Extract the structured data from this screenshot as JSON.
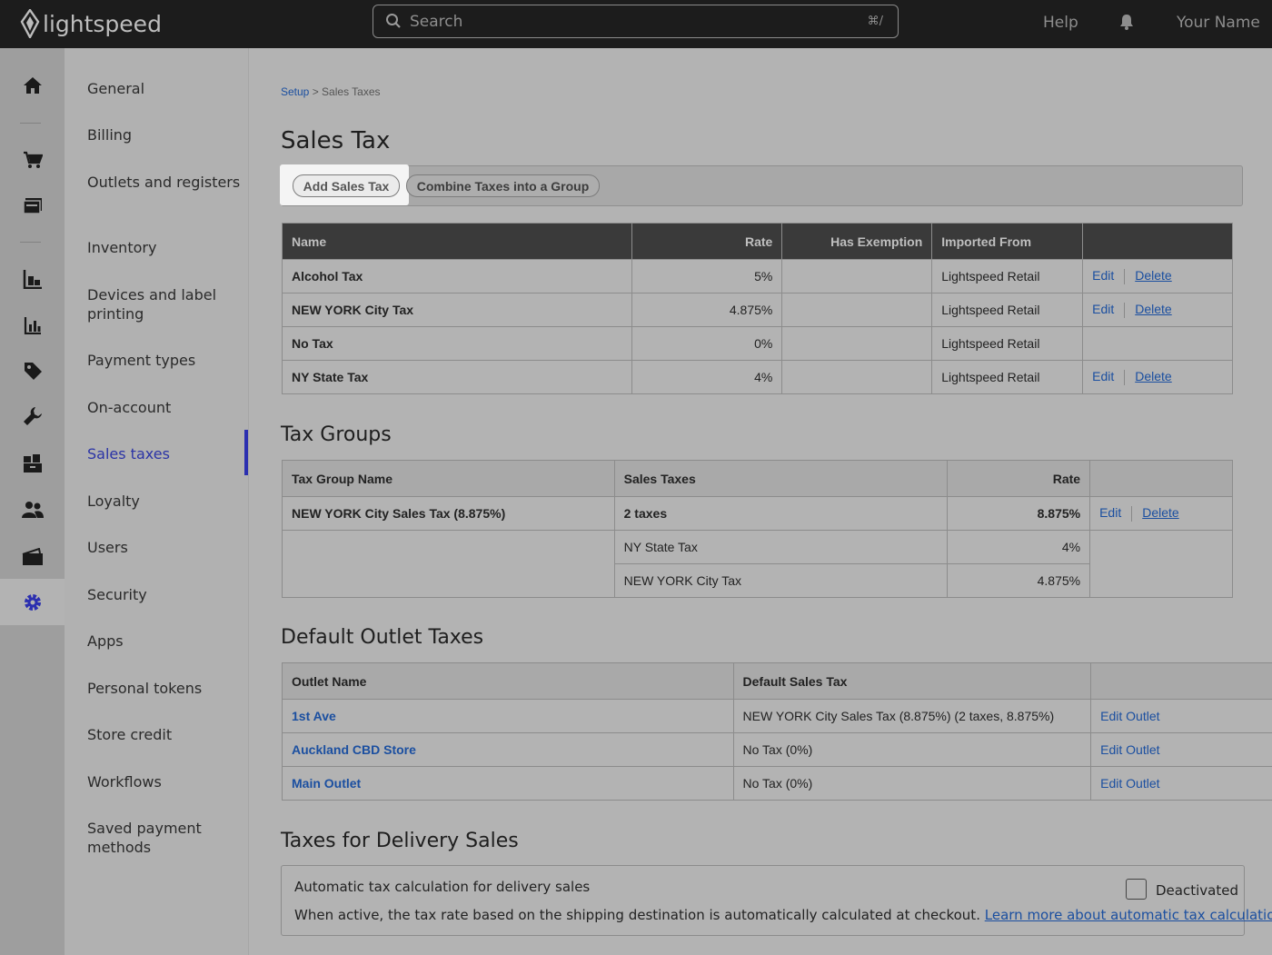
{
  "app": {
    "logo_text": "lightspeed"
  },
  "topbar": {
    "search_placeholder": "Search",
    "search_shortcut": "⌘/",
    "help": "Help",
    "user_name": "Your Name"
  },
  "rail_icons": [
    "home-icon",
    "cart-icon",
    "register-icon",
    "catalog-icon",
    "reports-icon",
    "tag-icon",
    "wrench-icon",
    "inventory-icon",
    "customers-icon",
    "wallet-icon",
    "gear-icon"
  ],
  "settings_nav": [
    "General",
    "Billing",
    "Outlets and registers",
    "Inventory",
    "Devices and label printing",
    "Payment types",
    "On-account",
    "Sales taxes",
    "Loyalty",
    "Users",
    "Security",
    "Apps",
    "Personal tokens",
    "Store credit",
    "Workflows",
    "Saved payment methods"
  ],
  "breadcrumb": {
    "root": "Setup",
    "current": "> Sales Taxes"
  },
  "page_title": "Sales Tax",
  "toolbar": {
    "add": "Add Sales Tax",
    "combine": "Combine Taxes into a Group"
  },
  "sales_tax_table": {
    "headers": {
      "name": "Name",
      "rate": "Rate",
      "exemption": "Has Exemption",
      "imported": "Imported From"
    },
    "rows": [
      {
        "name": "Alcohol Tax",
        "rate": "5%",
        "exemption": "",
        "imported": "Lightspeed Retail",
        "edit": "Edit",
        "delete": "Delete"
      },
      {
        "name": "NEW YORK City Tax",
        "rate": "4.875%",
        "exemption": "",
        "imported": "Lightspeed Retail",
        "edit": "Edit",
        "delete": "Delete"
      },
      {
        "name": "No Tax",
        "rate": "0%",
        "exemption": "",
        "imported": "Lightspeed Retail",
        "edit": "",
        "delete": ""
      },
      {
        "name": "NY State Tax",
        "rate": "4%",
        "exemption": "",
        "imported": "Lightspeed Retail",
        "edit": "Edit",
        "delete": "Delete"
      }
    ]
  },
  "tax_groups": {
    "title": "Tax Groups",
    "headers": {
      "name": "Tax Group Name",
      "taxes": "Sales Taxes",
      "rate": "Rate"
    },
    "group": {
      "name": "NEW YORK City Sales Tax (8.875%)",
      "taxes": "2 taxes",
      "rate": "8.875%",
      "edit": "Edit",
      "delete": "Delete"
    },
    "components": [
      {
        "name": "NY State Tax",
        "rate": "4%"
      },
      {
        "name": "NEW YORK City Tax",
        "rate": "4.875%"
      }
    ]
  },
  "default_outlet_taxes": {
    "title": "Default Outlet Taxes",
    "headers": {
      "outlet": "Outlet Name",
      "tax": "Default Sales Tax"
    },
    "rows": [
      {
        "outlet": "1st Ave",
        "tax": "NEW YORK City Sales Tax (8.875%) (2 taxes, 8.875%)",
        "action": "Edit Outlet"
      },
      {
        "outlet": "Auckland CBD Store",
        "tax": "No Tax (0%)",
        "action": "Edit Outlet"
      },
      {
        "outlet": "Main Outlet",
        "tax": "No Tax (0%)",
        "action": "Edit Outlet"
      }
    ]
  },
  "delivery": {
    "title": "Taxes for Delivery Sales",
    "card_title": "Automatic tax calculation for delivery sales",
    "description": "When active, the tax rate based on the shipping destination is automatically calculated at checkout.",
    "link": "Learn more about automatic tax calculation",
    "toggle_label": "Deactivated",
    "toggle_checked": false
  }
}
